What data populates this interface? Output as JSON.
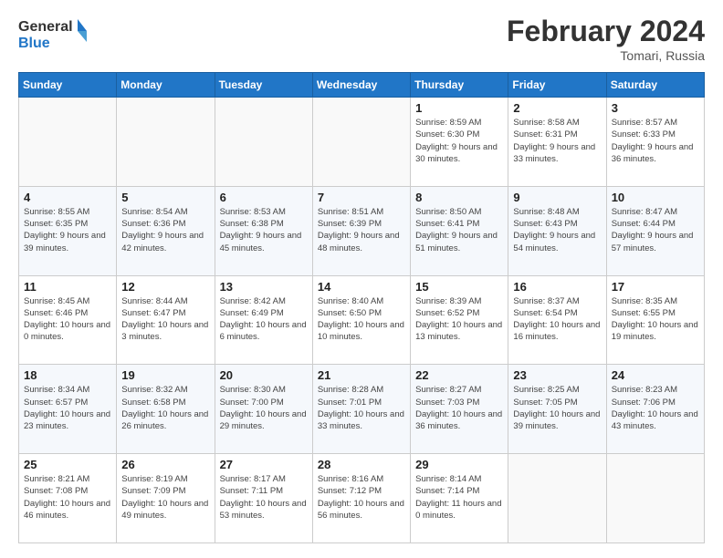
{
  "logo": {
    "line1": "General",
    "line2": "Blue"
  },
  "header": {
    "month_year": "February 2024",
    "location": "Tomari, Russia"
  },
  "weekdays": [
    "Sunday",
    "Monday",
    "Tuesday",
    "Wednesday",
    "Thursday",
    "Friday",
    "Saturday"
  ],
  "weeks": [
    [
      {
        "day": "",
        "info": ""
      },
      {
        "day": "",
        "info": ""
      },
      {
        "day": "",
        "info": ""
      },
      {
        "day": "",
        "info": ""
      },
      {
        "day": "1",
        "info": "Sunrise: 8:59 AM\nSunset: 6:30 PM\nDaylight: 9 hours and 30 minutes."
      },
      {
        "day": "2",
        "info": "Sunrise: 8:58 AM\nSunset: 6:31 PM\nDaylight: 9 hours and 33 minutes."
      },
      {
        "day": "3",
        "info": "Sunrise: 8:57 AM\nSunset: 6:33 PM\nDaylight: 9 hours and 36 minutes."
      }
    ],
    [
      {
        "day": "4",
        "info": "Sunrise: 8:55 AM\nSunset: 6:35 PM\nDaylight: 9 hours and 39 minutes."
      },
      {
        "day": "5",
        "info": "Sunrise: 8:54 AM\nSunset: 6:36 PM\nDaylight: 9 hours and 42 minutes."
      },
      {
        "day": "6",
        "info": "Sunrise: 8:53 AM\nSunset: 6:38 PM\nDaylight: 9 hours and 45 minutes."
      },
      {
        "day": "7",
        "info": "Sunrise: 8:51 AM\nSunset: 6:39 PM\nDaylight: 9 hours and 48 minutes."
      },
      {
        "day": "8",
        "info": "Sunrise: 8:50 AM\nSunset: 6:41 PM\nDaylight: 9 hours and 51 minutes."
      },
      {
        "day": "9",
        "info": "Sunrise: 8:48 AM\nSunset: 6:43 PM\nDaylight: 9 hours and 54 minutes."
      },
      {
        "day": "10",
        "info": "Sunrise: 8:47 AM\nSunset: 6:44 PM\nDaylight: 9 hours and 57 minutes."
      }
    ],
    [
      {
        "day": "11",
        "info": "Sunrise: 8:45 AM\nSunset: 6:46 PM\nDaylight: 10 hours and 0 minutes."
      },
      {
        "day": "12",
        "info": "Sunrise: 8:44 AM\nSunset: 6:47 PM\nDaylight: 10 hours and 3 minutes."
      },
      {
        "day": "13",
        "info": "Sunrise: 8:42 AM\nSunset: 6:49 PM\nDaylight: 10 hours and 6 minutes."
      },
      {
        "day": "14",
        "info": "Sunrise: 8:40 AM\nSunset: 6:50 PM\nDaylight: 10 hours and 10 minutes."
      },
      {
        "day": "15",
        "info": "Sunrise: 8:39 AM\nSunset: 6:52 PM\nDaylight: 10 hours and 13 minutes."
      },
      {
        "day": "16",
        "info": "Sunrise: 8:37 AM\nSunset: 6:54 PM\nDaylight: 10 hours and 16 minutes."
      },
      {
        "day": "17",
        "info": "Sunrise: 8:35 AM\nSunset: 6:55 PM\nDaylight: 10 hours and 19 minutes."
      }
    ],
    [
      {
        "day": "18",
        "info": "Sunrise: 8:34 AM\nSunset: 6:57 PM\nDaylight: 10 hours and 23 minutes."
      },
      {
        "day": "19",
        "info": "Sunrise: 8:32 AM\nSunset: 6:58 PM\nDaylight: 10 hours and 26 minutes."
      },
      {
        "day": "20",
        "info": "Sunrise: 8:30 AM\nSunset: 7:00 PM\nDaylight: 10 hours and 29 minutes."
      },
      {
        "day": "21",
        "info": "Sunrise: 8:28 AM\nSunset: 7:01 PM\nDaylight: 10 hours and 33 minutes."
      },
      {
        "day": "22",
        "info": "Sunrise: 8:27 AM\nSunset: 7:03 PM\nDaylight: 10 hours and 36 minutes."
      },
      {
        "day": "23",
        "info": "Sunrise: 8:25 AM\nSunset: 7:05 PM\nDaylight: 10 hours and 39 minutes."
      },
      {
        "day": "24",
        "info": "Sunrise: 8:23 AM\nSunset: 7:06 PM\nDaylight: 10 hours and 43 minutes."
      }
    ],
    [
      {
        "day": "25",
        "info": "Sunrise: 8:21 AM\nSunset: 7:08 PM\nDaylight: 10 hours and 46 minutes."
      },
      {
        "day": "26",
        "info": "Sunrise: 8:19 AM\nSunset: 7:09 PM\nDaylight: 10 hours and 49 minutes."
      },
      {
        "day": "27",
        "info": "Sunrise: 8:17 AM\nSunset: 7:11 PM\nDaylight: 10 hours and 53 minutes."
      },
      {
        "day": "28",
        "info": "Sunrise: 8:16 AM\nSunset: 7:12 PM\nDaylight: 10 hours and 56 minutes."
      },
      {
        "day": "29",
        "info": "Sunrise: 8:14 AM\nSunset: 7:14 PM\nDaylight: 11 hours and 0 minutes."
      },
      {
        "day": "",
        "info": ""
      },
      {
        "day": "",
        "info": ""
      }
    ]
  ]
}
